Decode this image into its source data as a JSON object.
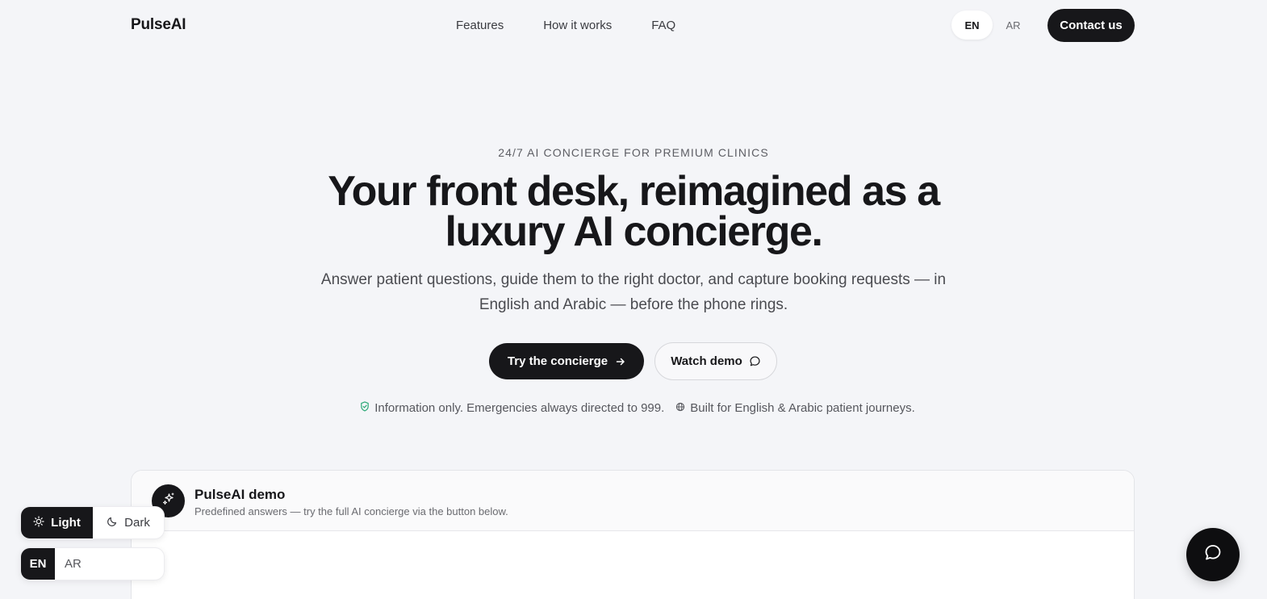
{
  "nav": {
    "logo": "PulseAI",
    "links": [
      "Features",
      "How it works",
      "FAQ"
    ],
    "lang": {
      "en": "EN",
      "ar": "AR",
      "active": "EN"
    },
    "contact_label": "Contact us"
  },
  "hero": {
    "eyebrow": "24/7 AI CONCIERGE FOR PREMIUM CLINICS",
    "headline_line1": "Your front desk, reimagined as a",
    "headline_line2": "luxury AI concierge.",
    "subhead": "Answer patient questions, guide them to the right doctor, and capture booking requests — in English and Arabic — before the phone rings.",
    "primary_cta": "Try the concierge",
    "secondary_cta": "Watch demo",
    "trust": [
      {
        "icon": "shield-check-icon",
        "text": "Information only. Emergencies always directed to 999."
      },
      {
        "icon": "globe-icon",
        "text": "Built for English & Arabic patient journeys."
      }
    ]
  },
  "demo": {
    "avatar_icon": "sparkles-icon",
    "title": "PulseAI demo",
    "subtitle": "Predefined answers — try the full AI concierge via the button below."
  },
  "floating": {
    "theme": {
      "light": "Light",
      "dark": "Dark",
      "active": "Light"
    },
    "lang": {
      "en": "EN",
      "ar": "AR",
      "active": "EN"
    },
    "chat_icon": "chat-bubble-icon"
  },
  "colors": {
    "background": "#f4f5f8",
    "ink": "#17171a",
    "accent_shield": "#2aa876"
  }
}
